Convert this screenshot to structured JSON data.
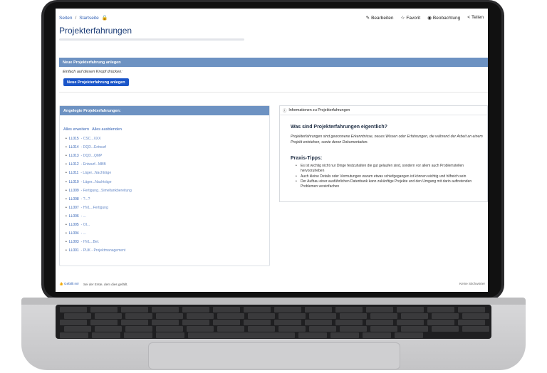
{
  "breadcrumb": {
    "items": [
      "Seiten",
      "Startseite"
    ]
  },
  "actions": {
    "edit": "Bearbeiten",
    "favorite": "Favorit",
    "watch": "Beobachtung",
    "share": "Teilen"
  },
  "page": {
    "title": "Projekterfahrungen"
  },
  "create_panel": {
    "header": "Neue Projekterfahrung anlegen",
    "hint": "Einfach auf diesen Knopf drücken:",
    "button": "Neue Projekterfahrung anlegen"
  },
  "list_panel": {
    "header": "Angelegte Projekterfahrungen:",
    "expand_all": "Alles erweitern",
    "collapse_all": "Alles ausblenden",
    "items": [
      {
        "id": "LL015",
        "suffix": " - CSC...XXX"
      },
      {
        "id": "LL014",
        "suffix": " - DQD...Entwurf"
      },
      {
        "id": "LL013",
        "suffix": " - DQD...QMP"
      },
      {
        "id": "LL012",
        "suffix": " - Entwurf...MBB"
      },
      {
        "id": "LL011",
        "suffix": " - Läger...Nachträge"
      },
      {
        "id": "LL010",
        "suffix": " - Läger...Nachträge"
      },
      {
        "id": "LL009",
        "suffix": " - Fertigung...Simeltankbereitung"
      },
      {
        "id": "LL008",
        "suffix": " - ?...?"
      },
      {
        "id": "LL007",
        "suffix": " - HVL...Fertigung"
      },
      {
        "id": "LL006",
        "suffix": " - ..."
      },
      {
        "id": "LL005",
        "suffix": " - OI..."
      },
      {
        "id": "LL004",
        "suffix": " - ..."
      },
      {
        "id": "LL003",
        "suffix": " - HVL...Bel."
      },
      {
        "id": "LL001",
        "suffix": " - PUK - Projektmanagement"
      }
    ]
  },
  "info_panel": {
    "header": "Informationen zu Projekterfahrungen",
    "question": "Was sind Projekterfahrungen eigentlich?",
    "answer": "Projekterfahrungen sind gewonnene Erkenntnisse, neues Wissen oder Erfahrungen, die während der Arbeit an einem Projekt entstehen, sowie deren Dokumentation.",
    "tips_title": "Praxis-Tipps:",
    "tips": [
      "Es ist wichtig nicht nur Dinge festzuhalten die gut gelaufen sind, sondern vor allem auch Problemstellen hervorzuheben",
      "Auch kleine Details oder Vermutungen warum etwas schiefgegangen ist können wichtig und hilfreich sein",
      "Der Aufbau einer ausführlichen Datenbank kann zukünftige Projekte und den Umgang mit darin auftretenden Problemen vereinfachen"
    ]
  },
  "footer": {
    "like": "Gefällt mir",
    "like_text": "Sei der Erste, dem dies gefällt.",
    "labels": "Keine Stichwörter"
  },
  "colors": {
    "accent": "#1a55c9",
    "panel_header": "#6d92c2",
    "link": "#2f5fb3"
  }
}
